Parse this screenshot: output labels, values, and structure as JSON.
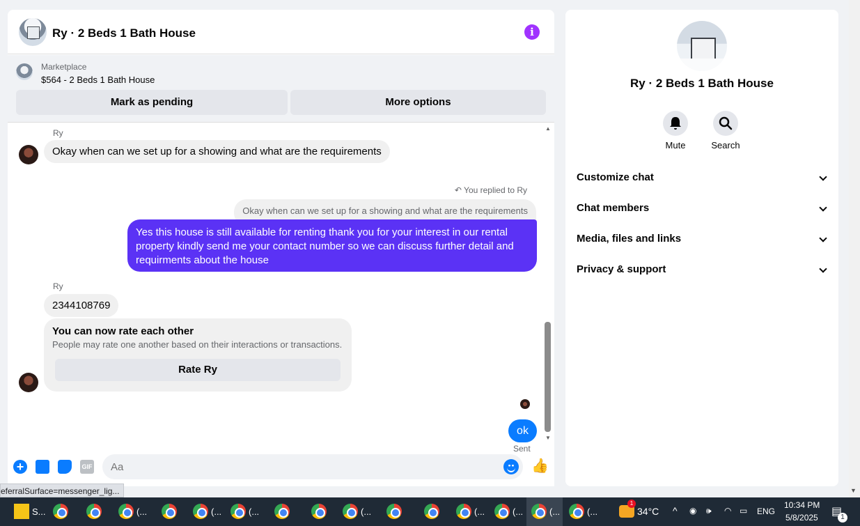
{
  "chat": {
    "title": "Ry · 2 Beds 1 Bath House",
    "marketplace": {
      "label": "Marketplace",
      "listing": "$564 - 2 Beds 1 Bath House",
      "mark_pending": "Mark as pending",
      "more_options": "More options"
    },
    "messages": {
      "sender1": "Ry",
      "msg1": "Okay when can we set up for a showing and what are the requirements",
      "reply_note": "You replied to Ry",
      "quoted": "Okay when can we set up for a showing and what are the requirements",
      "reply": "Yes this house is still available for renting thank you for your interest in our rental property kindly send me your contact number so we can discuss further detail and requirments about the house",
      "sender2": "Ry",
      "msg2": "2344108769",
      "rate_title": "You can now rate each other",
      "rate_desc": "People may rate one another based on their interactions or transactions.",
      "rate_button": "Rate Ry",
      "ok": "ok",
      "sent": "Sent"
    },
    "composer": {
      "placeholder": "Aa",
      "gif_label": "GIF"
    }
  },
  "info": {
    "name": "Ry · 2 Beds 1 Bath House",
    "mute": "Mute",
    "search": "Search",
    "sections": [
      "Customize chat",
      "Chat members",
      "Media, files and links",
      "Privacy & support"
    ]
  },
  "status_url": "eferralSurface=messenger_lig...",
  "taskbar": {
    "sticky_label": "S...",
    "tab_label": "(...",
    "weather": "34°C",
    "language": "ENG",
    "time": "10:34 PM",
    "date": "5/8/2025",
    "notification_count": "1",
    "weather_badge": "1"
  }
}
